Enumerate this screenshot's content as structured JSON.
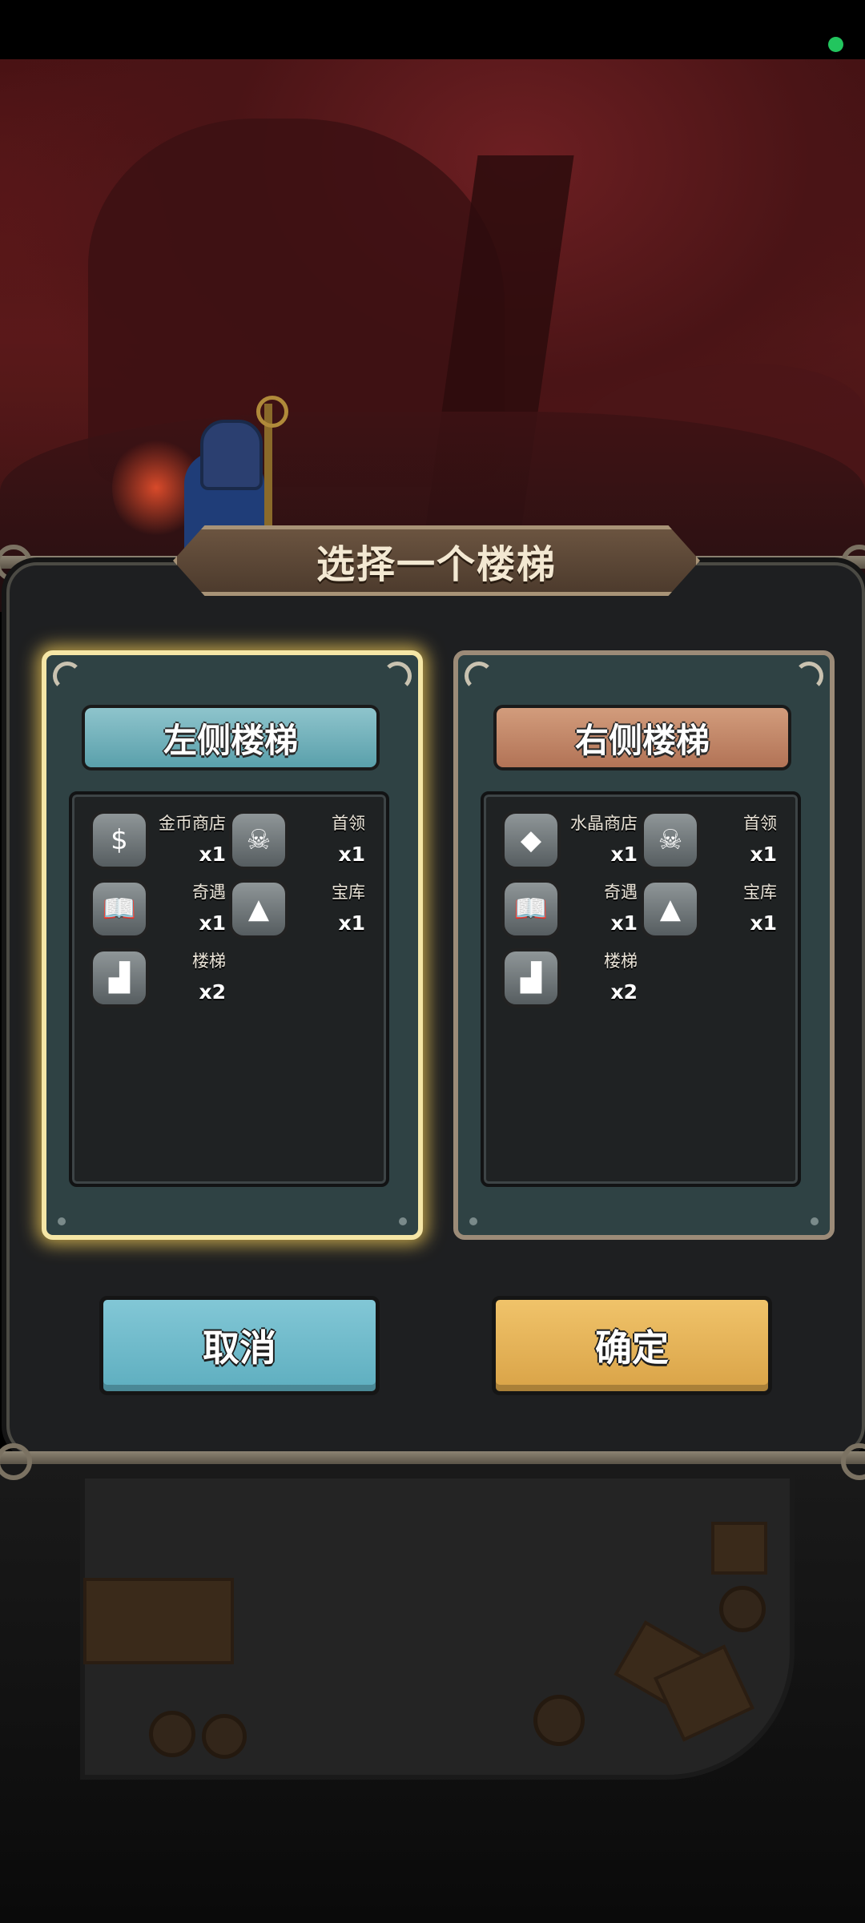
{
  "dialog": {
    "title": "选择一个楼梯",
    "cancel_label": "取消",
    "confirm_label": "确定"
  },
  "left_panel": {
    "header": "左侧楼梯",
    "selected": true,
    "items": [
      {
        "name": "金币商店",
        "count": "x1",
        "icon": "money-bag-icon",
        "glyph": "$"
      },
      {
        "name": "首领",
        "count": "x1",
        "icon": "boss-skull-icon",
        "glyph": "☠"
      },
      {
        "name": "奇遇",
        "count": "x1",
        "icon": "book-icon",
        "glyph": "📖"
      },
      {
        "name": "宝库",
        "count": "x1",
        "icon": "treasure-pyramid-icon",
        "glyph": "▲"
      },
      {
        "name": "楼梯",
        "count": "x2",
        "icon": "stairs-icon",
        "glyph": "▟"
      }
    ]
  },
  "right_panel": {
    "header": "右侧楼梯",
    "selected": false,
    "items": [
      {
        "name": "水晶商店",
        "count": "x1",
        "icon": "crystal-bag-icon",
        "glyph": "◆"
      },
      {
        "name": "首领",
        "count": "x1",
        "icon": "boss-skull-icon",
        "glyph": "☠"
      },
      {
        "name": "奇遇",
        "count": "x1",
        "icon": "book-icon",
        "glyph": "📖"
      },
      {
        "name": "宝库",
        "count": "x1",
        "icon": "treasure-pyramid-icon",
        "glyph": "▲"
      },
      {
        "name": "楼梯",
        "count": "x2",
        "icon": "stairs-icon",
        "glyph": "▟"
      }
    ]
  },
  "colors": {
    "selected_glow": "#f5e6a6",
    "left_header": "#5aa0ab",
    "right_header": "#b27356",
    "cancel_button": "#6ab8c8",
    "confirm_button": "#e6b25a",
    "status_dot": "#22c55e"
  }
}
